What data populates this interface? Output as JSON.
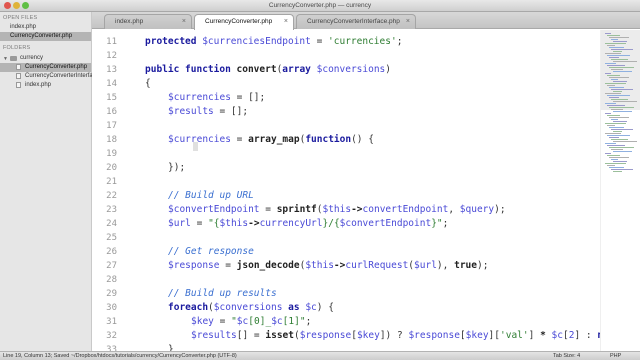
{
  "window": {
    "title": "CurrencyConverter.php — currency"
  },
  "sidebar": {
    "open_files_heading": "OPEN FILES",
    "open_files": [
      "index.php",
      "CurrencyConverter.php"
    ],
    "folders_heading": "FOLDERS",
    "folder_name": "currency",
    "folder_files": [
      "CurrencyConverter.php",
      "CurrencyConverterInterface.php",
      "index.php"
    ]
  },
  "tabs": [
    {
      "label": "index.php",
      "close": "×"
    },
    {
      "label": "CurrencyConverter.php",
      "close": "×"
    },
    {
      "label": "CurrencyConverterInterface.php",
      "close": "×"
    }
  ],
  "editor": {
    "line_numbers": [
      "11",
      "12",
      "13",
      "14",
      "15",
      "16",
      "17",
      "18",
      "19",
      "20",
      "21",
      "22",
      "23",
      "24",
      "25",
      "26",
      "27",
      "28",
      "29",
      "30",
      "31",
      "32",
      "33"
    ],
    "lines": {
      "l11": [
        "protected",
        " $currenciesEndpoint",
        " = ",
        "'currencies'",
        ";"
      ],
      "l13": [
        "public function",
        " convert",
        "(",
        "array",
        " $conversions",
        ")"
      ],
      "l14": "{",
      "l15": [
        "$currencies",
        " = [];"
      ],
      "l16": [
        "$results",
        " = [];"
      ],
      "l18": [
        "$currencies",
        " = ",
        "array_map",
        "(",
        "function",
        "() {"
      ],
      "l20": "});",
      "l22": "// Build up URL",
      "l23": [
        "$convertEndpoint",
        " = ",
        "sprintf",
        "(",
        "$this",
        "->",
        "convertEndpoint",
        ", ",
        "$query",
        ");"
      ],
      "l24": [
        "$url",
        " = ",
        "\"{",
        "$this",
        "->",
        "currencyUrl",
        "}/{",
        "$convertEndpoint",
        "}\"",
        ";"
      ],
      "l26": "// Get response",
      "l27": [
        "$response",
        " = ",
        "json_decode",
        "(",
        "$this",
        "->",
        "curlRequest",
        "(",
        "$url",
        "), ",
        "true",
        ");"
      ],
      "l29": "// Build up results",
      "l30": [
        "foreach",
        "(",
        "$conversions",
        " as ",
        "$c",
        ") {"
      ],
      "l31": [
        "$key",
        " = ",
        "\"",
        "$c",
        "[",
        "0",
        "]",
        "_",
        "$c",
        "[",
        "1",
        "]",
        "\"",
        ";"
      ],
      "l32": [
        "$results",
        "[] = ",
        "isset",
        "(",
        "$response",
        "[",
        "$key",
        "]) ? ",
        "$response",
        "[",
        "$key",
        "][",
        "'val'",
        "] ",
        "*",
        " ",
        "$c",
        "[",
        "2",
        "] : ",
        "nu"
      ],
      "l33": "}"
    }
  },
  "statusbar": {
    "left": "Line 19, Column 13; Saved ~/Dropbox/htdocs/tutorials/currency/CurrencyConverter.php (UTF-8)",
    "tab_size": "Tab Size: 4",
    "syntax": "PHP"
  },
  "colors": {
    "keyword": "#1a1a9e",
    "variable": "#4a4ad6",
    "string": "#2e7d32",
    "comment": "#3a6fd0",
    "sidebar_bg": "#e6e6e6"
  }
}
